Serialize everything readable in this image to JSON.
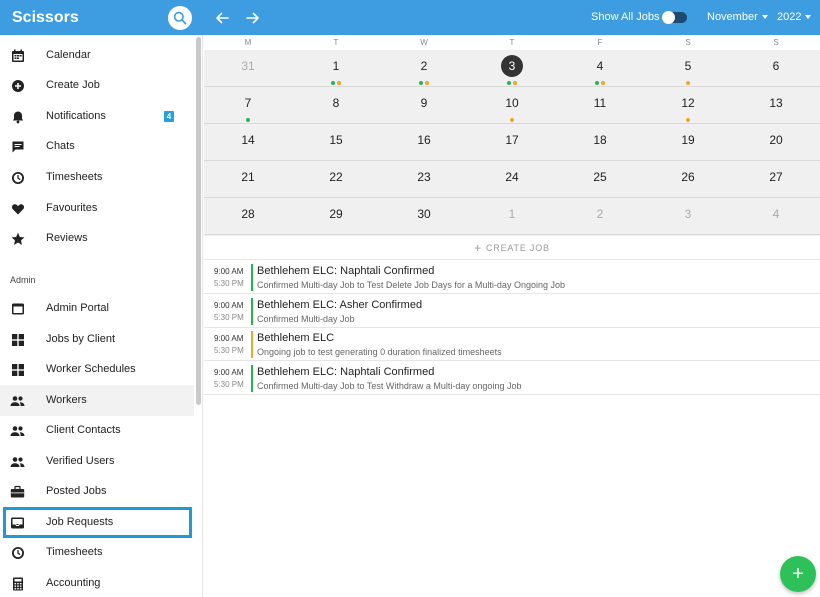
{
  "app": {
    "title": "Scissors"
  },
  "topbar": {
    "show_all_label": "Show All Jobs",
    "month": "November",
    "year": "2022"
  },
  "sidebar": {
    "items": [
      {
        "label": "Calendar",
        "icon": "calendar-icon"
      },
      {
        "label": "Create Job",
        "icon": "add-circle-icon"
      },
      {
        "label": "Notifications",
        "icon": "bell-icon",
        "badge": "4"
      },
      {
        "label": "Chats",
        "icon": "chat-icon"
      },
      {
        "label": "Timesheets",
        "icon": "clock-icon"
      },
      {
        "label": "Favourites",
        "icon": "heart-icon"
      },
      {
        "label": "Reviews",
        "icon": "star-icon"
      }
    ],
    "admin_label": "Admin",
    "admin_items": [
      {
        "label": "Admin Portal",
        "icon": "window-icon"
      },
      {
        "label": "Jobs by Client",
        "icon": "grid-icon"
      },
      {
        "label": "Worker Schedules",
        "icon": "grid-icon"
      },
      {
        "label": "Workers",
        "icon": "people-icon"
      },
      {
        "label": "Client Contacts",
        "icon": "people-icon"
      },
      {
        "label": "Verified Users",
        "icon": "people-icon"
      },
      {
        "label": "Posted Jobs",
        "icon": "briefcase-icon"
      },
      {
        "label": "Job Requests",
        "icon": "inbox-icon"
      },
      {
        "label": "Timesheets",
        "icon": "clock-icon"
      },
      {
        "label": "Accounting",
        "icon": "calculator-icon"
      }
    ]
  },
  "calendar": {
    "weekdays": [
      "M",
      "T",
      "W",
      "T",
      "F",
      "S",
      "S"
    ],
    "weeks": [
      [
        {
          "d": "31",
          "other": true,
          "dots": []
        },
        {
          "d": "1",
          "dots": [
            "green",
            "orange"
          ]
        },
        {
          "d": "2",
          "dots": [
            "green",
            "orange"
          ]
        },
        {
          "d": "3",
          "today": true,
          "dots": [
            "green",
            "orange"
          ]
        },
        {
          "d": "4",
          "dots": [
            "green",
            "orange"
          ]
        },
        {
          "d": "5",
          "dots": [
            "orange"
          ]
        },
        {
          "d": "6",
          "dots": []
        }
      ],
      [
        {
          "d": "7",
          "dots": [
            "green"
          ]
        },
        {
          "d": "8",
          "dots": []
        },
        {
          "d": "9",
          "dots": []
        },
        {
          "d": "10",
          "dots": [
            "orange"
          ]
        },
        {
          "d": "11",
          "dots": []
        },
        {
          "d": "12",
          "dots": [
            "orange"
          ]
        },
        {
          "d": "13",
          "dots": []
        }
      ],
      [
        {
          "d": "14",
          "dots": []
        },
        {
          "d": "15",
          "dots": []
        },
        {
          "d": "16",
          "dots": []
        },
        {
          "d": "17",
          "dots": []
        },
        {
          "d": "18",
          "dots": []
        },
        {
          "d": "19",
          "dots": []
        },
        {
          "d": "20",
          "dots": []
        }
      ],
      [
        {
          "d": "21",
          "dots": []
        },
        {
          "d": "22",
          "dots": []
        },
        {
          "d": "23",
          "dots": []
        },
        {
          "d": "24",
          "dots": []
        },
        {
          "d": "25",
          "dots": []
        },
        {
          "d": "26",
          "dots": []
        },
        {
          "d": "27",
          "dots": []
        }
      ],
      [
        {
          "d": "28",
          "dots": []
        },
        {
          "d": "29",
          "dots": []
        },
        {
          "d": "30",
          "dots": []
        },
        {
          "d": "1",
          "other": true,
          "dots": []
        },
        {
          "d": "2",
          "other": true,
          "dots": []
        },
        {
          "d": "3",
          "other": true,
          "dots": []
        },
        {
          "d": "4",
          "other": true,
          "dots": []
        }
      ]
    ],
    "create_job_label": "CREATE JOB"
  },
  "events": [
    {
      "start": "9:00 AM",
      "end": "5:30 PM",
      "title": "Bethlehem ELC: Naphtali Confirmed",
      "subtitle": "Confirmed Multi-day Job to Test Delete Job Days for a Multi-day Ongoing Job",
      "color": "#22b84e"
    },
    {
      "start": "9:00 AM",
      "end": "5:30 PM",
      "title": "Bethlehem ELC: Asher Confirmed",
      "subtitle": "Confirmed Multi-day Job",
      "color": "#22b84e"
    },
    {
      "start": "9:00 AM",
      "end": "5:30 PM",
      "title": "Bethlehem ELC",
      "subtitle": "Ongoing job to test generating 0 duration finalized timesheets",
      "color": "#f5a623"
    },
    {
      "start": "9:00 AM",
      "end": "5:30 PM",
      "title": "Bethlehem ELC: Naphtali Confirmed",
      "subtitle": "Confirmed Multi-day Job to Test Withdraw a Multi-day ongoing Job",
      "color": "#22b84e"
    }
  ],
  "fab": {
    "label": "+"
  },
  "colors": {
    "topbar": "#3d9de0",
    "accent_green": "#22b84e",
    "accent_orange": "#f5a623",
    "focus_outline": "#1e9ad6"
  }
}
